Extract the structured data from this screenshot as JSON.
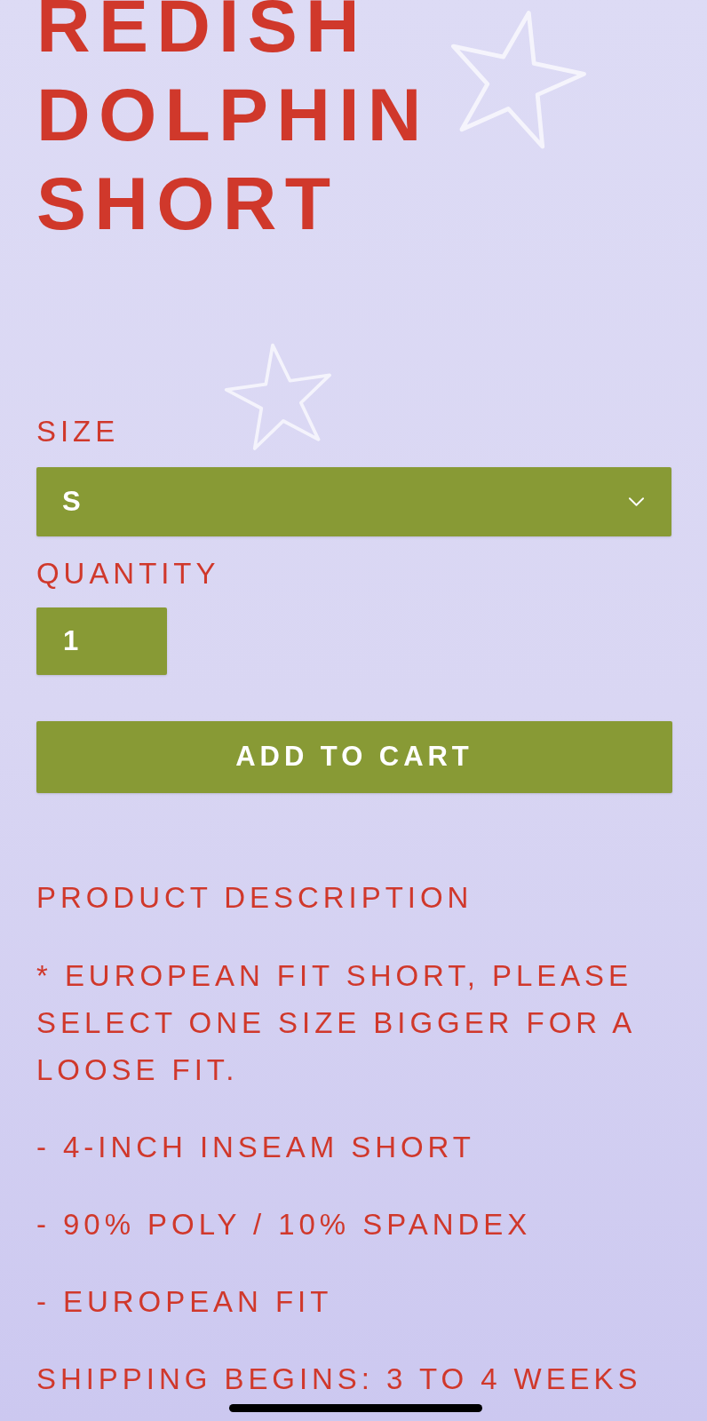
{
  "product": {
    "title": "REDISH DOLPHIN SHORT"
  },
  "options": {
    "size": {
      "label": "SIZE",
      "value": "S"
    },
    "quantity": {
      "label": "QUANTITY",
      "value": "1"
    }
  },
  "add_to_cart": {
    "label": "ADD TO CART"
  },
  "description": {
    "heading": "PRODUCT DESCRIPTION",
    "paragraphs": [
      "* EUROPEAN FIT SHORT, PLEASE SELECT ONE SIZE BIGGER FOR A LOOSE FIT.",
      "- 4-INCH INSEAM SHORT",
      "- 90% POLY / 10% SPANDEX",
      "- EUROPEAN FIT",
      "SHIPPING BEGINS: 3 TO 4 WEEKS"
    ]
  }
}
